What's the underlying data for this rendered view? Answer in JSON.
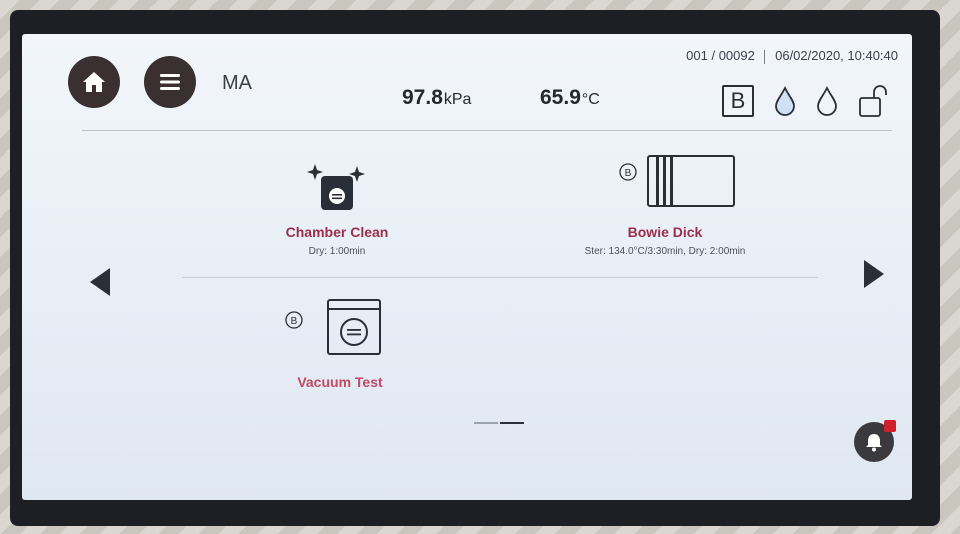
{
  "header": {
    "user": "MA",
    "counter": "001 / 00092",
    "datetime": "06/02/2020, 10:40:40",
    "pressure_value": "97.8",
    "pressure_unit": "kPa",
    "temperature_value": "65.9",
    "temperature_unit": "°C",
    "b_badge": "B"
  },
  "programs": [
    {
      "name": "Chamber Clean",
      "detail": "Dry: 1:00min"
    },
    {
      "name": "Bowie Dick",
      "detail": "Ster: 134.0°C/3:30min, Dry: 2:00min",
      "badge": "B"
    },
    {
      "name": "Vacuum Test",
      "badge": "B"
    }
  ],
  "pagination": {
    "current": 2,
    "total": 2
  },
  "icons": {
    "home": "home-icon",
    "menu": "menu-icon",
    "water1": "water-drop-icon",
    "water2": "water-drop-outline-icon",
    "lock": "unlock-icon",
    "alarm": "bell-icon"
  },
  "colors": {
    "program_name": "#9b2f4a",
    "button_dark": "#3a3031"
  }
}
